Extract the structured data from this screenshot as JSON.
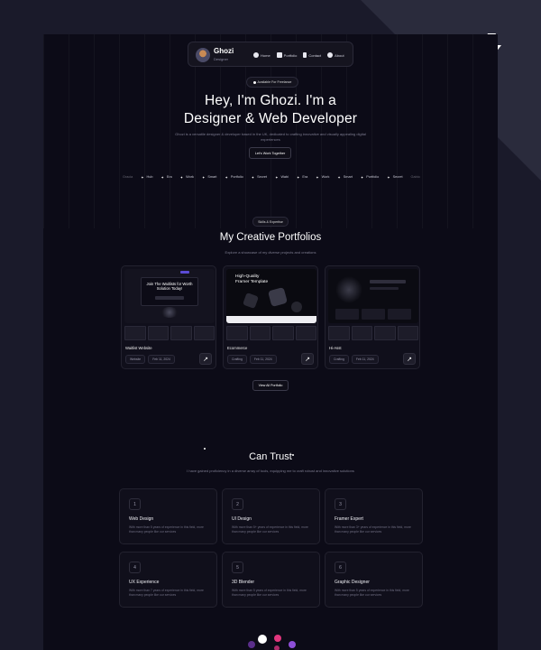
{
  "nav": {
    "name": "Ghozi",
    "role": "Designer",
    "links": [
      {
        "label": "Home",
        "icon": "home-icon"
      },
      {
        "label": "Portfolio",
        "icon": "portfolio-icon"
      },
      {
        "label": "Contact",
        "icon": "contact-icon"
      },
      {
        "label": "About",
        "icon": "user-icon"
      }
    ]
  },
  "hero": {
    "badge": "Available For Freelance",
    "title_line1": "Hey, I'm Ghozi. I'm a",
    "title_line2": "Designer & Web Developer",
    "subtitle": "Ghozi is a versatile designer & developer based in the UK, dedicated to crafting innovative and visually appealing digital experiences",
    "cta": "Let's Work Together"
  },
  "ticker": [
    "Gracia",
    "Hub",
    "Era",
    "Work",
    "Smart",
    "Portfolio",
    "Secret",
    "Wabi",
    "Era",
    "Work",
    "Smart",
    "Portfolio",
    "Secret",
    "Gabio"
  ],
  "portfolio": {
    "badge": "Skills & Expertise",
    "title": "My Creative Portfolios",
    "subtitle": "Explore a showcase of my diverse projects and creations",
    "thumb1_headline": "Join The Waitlists for Worth Solution Today!",
    "thumb2_headline": "High-Quality Framer Template",
    "cards": [
      {
        "title": "Waitlist Website",
        "tags": [
          "Website",
          "Feb 11, 2024"
        ]
      },
      {
        "title": "Ecommerce",
        "tags": [
          "Crafting",
          "Feb 11, 2024"
        ]
      },
      {
        "title": "Hi-Asst",
        "tags": [
          "Crafting",
          "Feb 11, 2024"
        ]
      }
    ],
    "view_all": "View All Portfolio"
  },
  "trust": {
    "title": "Can Trust",
    "subtitle": "I have gained proficiency in a diverse array of tools, equipping me to craft robust and innovative solutions",
    "skills": [
      {
        "num": "1",
        "title": "Web Design",
        "desc": "With more than 5 years of experience in this field, more than many people like our services"
      },
      {
        "num": "2",
        "title": "UI Design",
        "desc": "With more than 5+ years of experience in this field, more than many people like our services"
      },
      {
        "num": "3",
        "title": "Framer Expert",
        "desc": "With more than 3+ years of experience in this field, more than many people like our services"
      },
      {
        "num": "4",
        "title": "UX Experience",
        "desc": "With more than 7 years of experience in this field, more than many people like our services"
      },
      {
        "num": "5",
        "title": "3D Blender",
        "desc": "With more than 5 years of experience in this field, more than many people like our services"
      },
      {
        "num": "6",
        "title": "Graphic Designer",
        "desc": "With more than 5 years of experience in this field, more than many people like our services"
      }
    ]
  },
  "colors": {
    "page_bg": "#0c0b17",
    "outer_bg": "#1a1a2a",
    "accent_pink": "#e2367e",
    "accent_purple": "#8e4fd8"
  }
}
